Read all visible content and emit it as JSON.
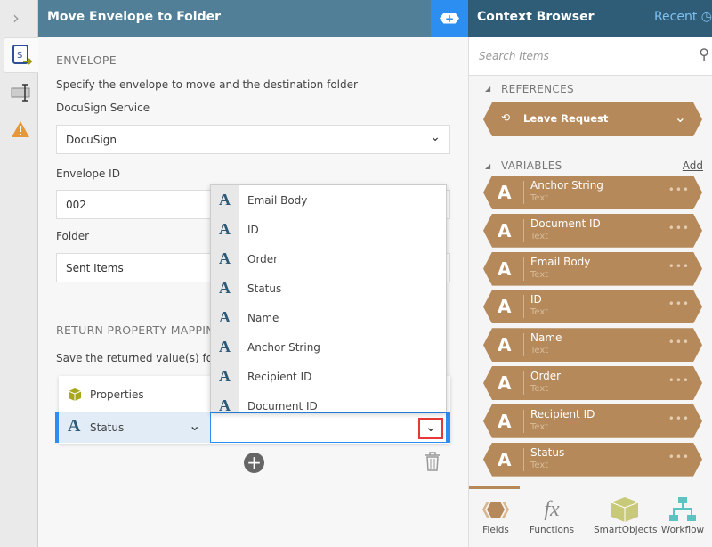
{
  "header": {
    "title": "Move Envelope to Folder"
  },
  "envelope": {
    "section": "ENVELOPE",
    "description": "Specify the envelope to move and the destination folder",
    "service_label": "DocuSign Service",
    "service_value": "DocuSign",
    "id_label": "Envelope ID",
    "id_value": "002",
    "folder_label": "Folder",
    "folder_value": "Sent Items"
  },
  "return": {
    "section": "RETURN PROPERTY MAPPIN",
    "description": "Save the returned value(s) for la",
    "properties_label": "Properties",
    "property": "Status"
  },
  "dropdown": {
    "items": [
      "Email Body",
      "ID",
      "Order",
      "Status",
      "Name",
      "Anchor String",
      "Recipient ID",
      "Document ID"
    ]
  },
  "context": {
    "title": "Context Browser",
    "recent": "Recent",
    "search_placeholder": "Search Items",
    "references_label": "REFERENCES",
    "reference": "Leave Request",
    "variables_label": "VARIABLES",
    "add": "Add",
    "variables": [
      {
        "name": "Anchor String",
        "type": "Text"
      },
      {
        "name": "Document ID",
        "type": "Text"
      },
      {
        "name": "Email Body",
        "type": "Text"
      },
      {
        "name": "ID",
        "type": "Text"
      },
      {
        "name": "Name",
        "type": "Text"
      },
      {
        "name": "Order",
        "type": "Text"
      },
      {
        "name": "Recipient ID",
        "type": "Text"
      },
      {
        "name": "Status",
        "type": "Text"
      }
    ],
    "tabs": [
      "Fields",
      "Functions",
      "SmartObjects",
      "Workflow"
    ]
  },
  "colors": {
    "header": "#527f98",
    "accent": "#2b8ef0",
    "pill": "#b5895a",
    "highlight": "#e53935"
  }
}
